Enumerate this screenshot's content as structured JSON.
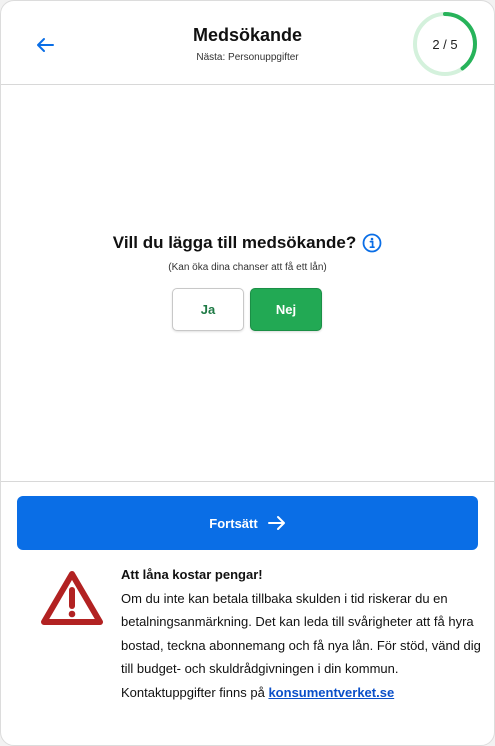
{
  "header": {
    "title": "Medsökande",
    "subtitle": "Nästa: Personuppgifter",
    "back_icon": "arrow-left-icon",
    "progress": {
      "label": "2 / 5",
      "current": 2,
      "total": 5,
      "color": "#27b35a",
      "track_color": "#d4f1dc"
    }
  },
  "question": {
    "text": "Vill du lägga till medsökande?",
    "info_icon": "info-icon",
    "hint": "(Kan öka dina chanser att få ett lån)",
    "options": {
      "yes": "Ja",
      "no": "Nej",
      "selected": "no"
    }
  },
  "continue_button": {
    "label": "Fortsätt",
    "icon": "arrow-right-icon",
    "color": "#0a6ee6"
  },
  "warning": {
    "icon": "warning-triangle-icon",
    "title": "Att låna kostar pengar!",
    "text": "Om du inte kan betala tillbaka skulden i tid riskerar du en betalningsanmärkning. Det kan leda till svårigheter att få hyra bostad, teckna abonnemang och få nya lån. För stöd, vänd dig till budget- och skuldrådgivningen i din kommun. Kontaktuppgifter finns på",
    "link_text": "konsumentverket.se",
    "icon_color": "#b22222"
  }
}
